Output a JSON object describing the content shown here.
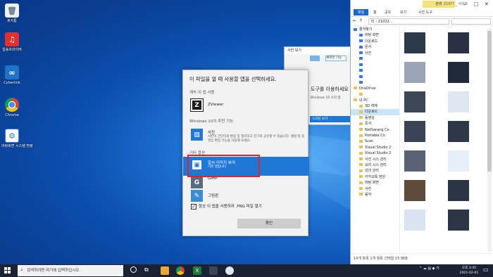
{
  "desktop": {
    "icons": [
      {
        "label": "휴지통",
        "icon": "recycle-bin-icon",
        "color": "#e8e8e8"
      },
      {
        "label": "알송프라이버",
        "icon": "alsong-icon",
        "color": "#e03030"
      },
      {
        "label": "Cyberlink",
        "icon": "infinity-icon",
        "color": "#1f73c9"
      },
      {
        "label": "Chrome",
        "icon": "chrome-icon",
        "color": "#e9c434"
      },
      {
        "label": "바탕화면 시스템 명령",
        "icon": "system-icon",
        "color": "#2f7fd3"
      }
    ]
  },
  "explorer": {
    "title_badge": "관리",
    "title_text": "210?? _ 사이트",
    "ribbon_tabs": [
      "파일",
      "홈",
      "공유",
      "보기",
      "사진 도구"
    ],
    "address": "티 › 21022...",
    "nav_items": [
      "즐겨찾기",
      "바탕 화면",
      "다운로드",
      "문서",
      "사진",
      "",
      "",
      "",
      "",
      "",
      "OneDrive",
      "",
      "내 PC",
      "3D 개체",
      "다운로드",
      "동영상",
      "문서",
      "NetSarang Co",
      "Portable Co",
      "Scan",
      "Visual Studio 2",
      "Visual Studio 2",
      "사진 시스 관리",
      "요리 시스 관리",
      "강의 관리",
      "카카오톡 받은",
      "바탕 화면",
      "사진",
      "음악"
    ],
    "selected_nav": 14,
    "status": "14개 항목 1개 항목 선택함 15.9KB",
    "thumb_colors": [
      "#2d3a4a",
      "#2a3140",
      "#9aa5b8",
      "#1f2a3a",
      "#3b4656",
      "#dfe7f2",
      "#3a4453",
      "#2e3848",
      "#5a6275",
      "#e6eef8",
      "#5d4a3b",
      "#2a3444",
      "#d9e4f1",
      "#2b3646"
    ]
  },
  "mini_window": {
    "title": "사진 보기",
    "items": [
      "새로운 기능",
      "앱 찾기",
      "도구를 이용하세요",
      "Windows 10 사진 앱",
      "스크린 보기"
    ]
  },
  "dialog": {
    "title": "이 파일을 열 때 사용할 앱을 선택하세요.",
    "section_current": "계속 이 앱 사용",
    "section_windows": "Windows 10의 추천 기능",
    "section_other": "기타 옵션",
    "apps": [
      {
        "name": "ZViewer",
        "desc": "",
        "icon": "zviewer-icon",
        "color": "#1a1a1a",
        "glyph": "Z"
      },
      {
        "name": "사진",
        "desc": "사진이 간단하게 편집 및 정리하고 친구와 공유할 수 있습니다. 앨범 및 동영상 편집 기능을 사용해 보세요.",
        "icon": "photos-icon",
        "color": "#1f77d6",
        "glyph": "▨"
      },
      {
        "name": "알씨 이미지 뷰어",
        "desc": "기본 앱입니다",
        "icon": "image-viewer-icon",
        "color": "#1f77d6",
        "glyph": "▣"
      },
      {
        "name": "GIMP",
        "desc": "",
        "icon": "gimp-icon",
        "color": "#5b6b7d",
        "glyph": "G"
      },
      {
        "name": "그림판",
        "desc": "",
        "icon": "paint-icon",
        "color": "#3b8bd3",
        "glyph": "✎"
      }
    ],
    "selected_app": 2,
    "checkbox_label": "항상 이 앱을 사용하여 .PNG 파일 열기",
    "checkbox_checked": true,
    "ok_label": "확인"
  },
  "taskbar": {
    "search_placeholder": "검색하려면 여기에 입력하십시오.",
    "tray": "^ ☁ ▤ ◆ 가",
    "time": "오후 3:45",
    "date": "2021-02-01"
  }
}
